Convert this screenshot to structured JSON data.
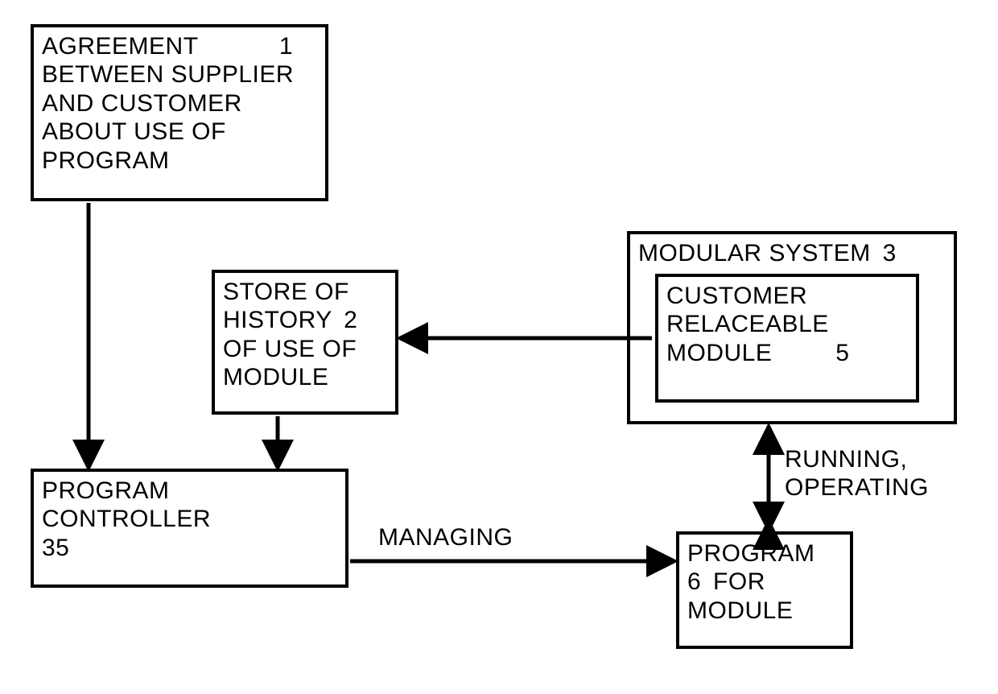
{
  "boxes": {
    "agreement": {
      "text_l1": "AGREEMENT",
      "num": "1",
      "text_l2": "BETWEEN SUPPLIER",
      "text_l3": "AND CUSTOMER",
      "text_l4": "ABOUT USE OF",
      "text_l5": "PROGRAM"
    },
    "store": {
      "text_l1": "STORE OF",
      "text_l2a": "HISTORY",
      "num": "2",
      "text_l3": "OF USE OF",
      "text_l4": "MODULE"
    },
    "modular_system": {
      "text": "MODULAR SYSTEM",
      "num": "3"
    },
    "crm": {
      "text_l1": "CUSTOMER",
      "text_l2": "RELACEABLE",
      "text_l3a": "MODULE",
      "num": "5"
    },
    "controller": {
      "text_l1": "PROGRAM",
      "text_l2": "CONTROLLER",
      "num": "35"
    },
    "program_module": {
      "text_l1": "PROGRAM",
      "text_l2a": "6",
      "text_l2b": "FOR",
      "text_l3": "MODULE"
    }
  },
  "labels": {
    "managing": "MANAGING",
    "running_l1": "RUNNING,",
    "running_l2": "OPERATING"
  }
}
